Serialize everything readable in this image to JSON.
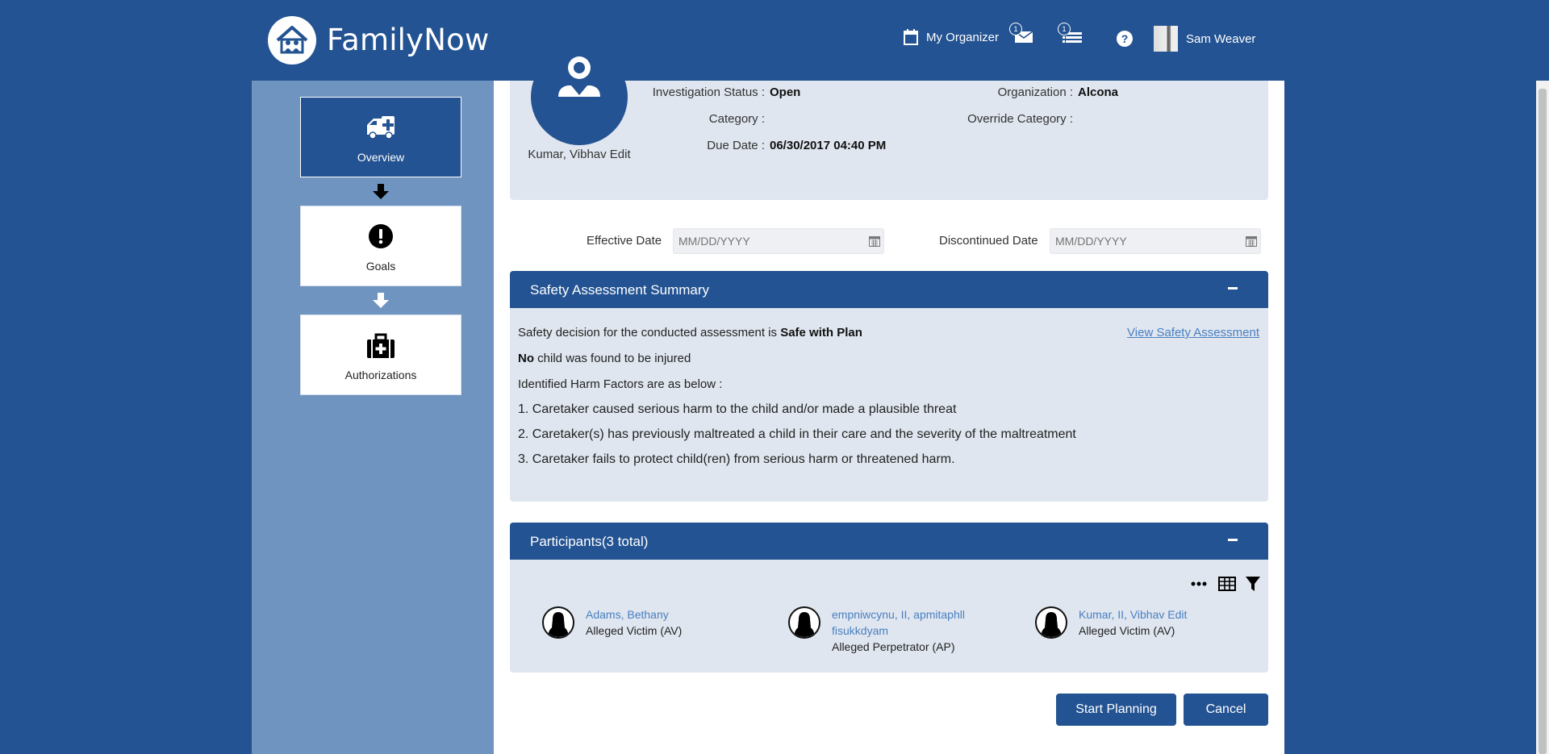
{
  "app": {
    "brand": "FamilyNow"
  },
  "header": {
    "organizer_label": "My Organizer",
    "mail_badge": "1",
    "tasks_badge": "1",
    "help_label": "?",
    "user_name": "Sam Weaver"
  },
  "sidebar": {
    "steps": [
      {
        "label": "Overview",
        "icon": "ambulance-icon",
        "active": true
      },
      {
        "label": "Goals",
        "icon": "exclamation-circle-icon",
        "active": false
      },
      {
        "label": "Authorizations",
        "icon": "medkit-icon",
        "active": false
      }
    ]
  },
  "profile": {
    "name": "Kumar, Vibhav Edit",
    "investigation_status_label": "Investigation Status :",
    "investigation_status": "Open",
    "category_label": "Category :",
    "category": "",
    "due_date_label": "Due Date :",
    "due_date": "06/30/2017 04:40 PM",
    "organization_label": "Organization :",
    "organization": "Alcona",
    "override_category_label": "Override Category :",
    "override_category": ""
  },
  "dates": {
    "effective_label": "Effective Date",
    "effective_placeholder": "MM/DD/YYYY",
    "discontinued_label": "Discontinued Date",
    "discontinued_placeholder": "MM/DD/YYYY"
  },
  "safety": {
    "title": "Safety Assessment Summary",
    "decision_prefix": "Safety decision for the conducted assessment is",
    "decision": "Safe with Plan",
    "view_link": "View Safety Assessment",
    "injured_bold": "No",
    "injured_text": "child was found to be injured",
    "factors_intro": "Identified Harm Factors are as below :",
    "factors": [
      "1. Caretaker caused serious harm to the child and/or made a plausible threat",
      "2. Caretaker(s) has previously maltreated a child in their care and the severity of the maltreatment",
      "3. Caretaker fails to protect child(ren) from serious harm or threatened harm."
    ]
  },
  "participants": {
    "title": "Participants(3 total)",
    "items": [
      {
        "name": "Adams, Bethany",
        "role": "Alleged Victim (AV)"
      },
      {
        "name": "empniwcynu, II, apmitaphll fisukkdyam",
        "role": "Alleged Perpetrator (AP)"
      },
      {
        "name": "Kumar, II, Vibhav Edit",
        "role": "Alleged Victim (AV)"
      }
    ]
  },
  "actions": {
    "start_label": "Start Planning",
    "cancel_label": "Cancel"
  },
  "colors": {
    "primary": "#235392",
    "sidebar": "#6f94bf",
    "panel_bg": "#dfe6ef",
    "link": "#4a7fc1"
  }
}
